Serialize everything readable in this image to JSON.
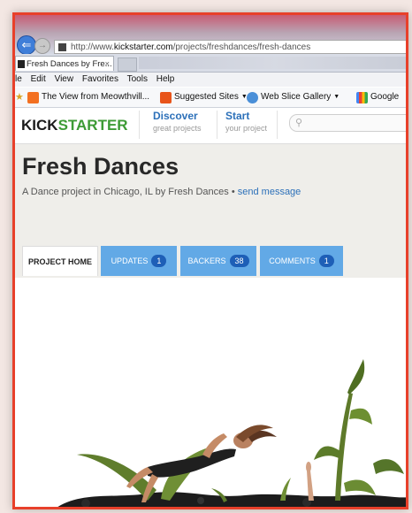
{
  "browser": {
    "address_prefix": "http://www.",
    "address_domain": "kickstarter.com",
    "address_path": "/projects/freshdances/fresh-dances",
    "tab_title": "Fresh Dances by Fre...",
    "tab_close": "×"
  },
  "menu": [
    "le",
    "Edit",
    "View",
    "Favorites",
    "Tools",
    "Help"
  ],
  "favorites": {
    "item1": "The View from Meowthvill...",
    "item2": "Suggested Sites",
    "item3": "Web Slice Gallery",
    "item4": "Google"
  },
  "kickstarter": {
    "logo_black": "KICK",
    "logo_green": "STARTER",
    "discover_label": "Discover",
    "discover_sub": "great projects",
    "start_label": "Start",
    "start_sub": "your project"
  },
  "project": {
    "title": "Fresh Dances",
    "subtitle": "A Dance project in Chicago, IL by Fresh Dances •",
    "send_message": "send message"
  },
  "tabs": [
    {
      "label": "PROJECT HOME"
    },
    {
      "label": "UPDATES",
      "count": "1"
    },
    {
      "label": "BACKERS",
      "count": "38"
    },
    {
      "label": "COMMENTS",
      "count": "1"
    }
  ],
  "colors": {
    "accent": "#2c70b9",
    "tab_blue": "#62a9e6",
    "badge": "#1e5fb7",
    "brand_green": "#3d9b35",
    "frame": "#e8402a"
  }
}
